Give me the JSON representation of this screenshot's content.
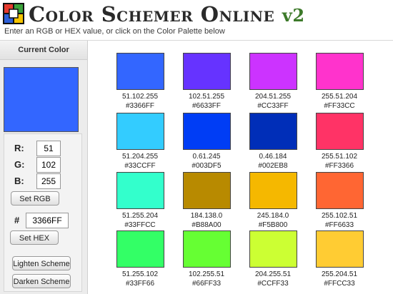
{
  "header": {
    "title": "Color Schemer Online",
    "version": "v2",
    "subtitle": "Enter an RGB or HEX value, or click on the Color Palette below"
  },
  "sidebar": {
    "heading": "Current Color",
    "current_color": "#3366FF",
    "r_label": "R:",
    "g_label": "G:",
    "b_label": "B:",
    "r_value": "51",
    "g_value": "102",
    "b_value": "255",
    "set_rgb_label": "Set RGB",
    "hash_label": "#",
    "hex_value": "3366FF",
    "set_hex_label": "Set HEX",
    "lighten_label": "Lighten Scheme",
    "darken_label": "Darken Scheme"
  },
  "palette": [
    {
      "rgb": "51.102.255",
      "hex": "#3366FF"
    },
    {
      "rgb": "102.51.255",
      "hex": "#6633FF"
    },
    {
      "rgb": "204.51.255",
      "hex": "#CC33FF"
    },
    {
      "rgb": "255.51.204",
      "hex": "#FF33CC"
    },
    {
      "rgb": "51.204.255",
      "hex": "#33CCFF"
    },
    {
      "rgb": "0.61.245",
      "hex": "#003DF5"
    },
    {
      "rgb": "0.46.184",
      "hex": "#002EB8"
    },
    {
      "rgb": "255.51.102",
      "hex": "#FF3366"
    },
    {
      "rgb": "51.255.204",
      "hex": "#33FFCC"
    },
    {
      "rgb": "184.138.0",
      "hex": "#B88A00"
    },
    {
      "rgb": "245.184.0",
      "hex": "#F5B800"
    },
    {
      "rgb": "255.102.51",
      "hex": "#FF6633"
    },
    {
      "rgb": "51.255.102",
      "hex": "#33FF66"
    },
    {
      "rgb": "102.255.51",
      "hex": "#66FF33"
    },
    {
      "rgb": "204.255.51",
      "hex": "#CCFF33"
    },
    {
      "rgb": "255.204.51",
      "hex": "#FFCC33"
    }
  ]
}
